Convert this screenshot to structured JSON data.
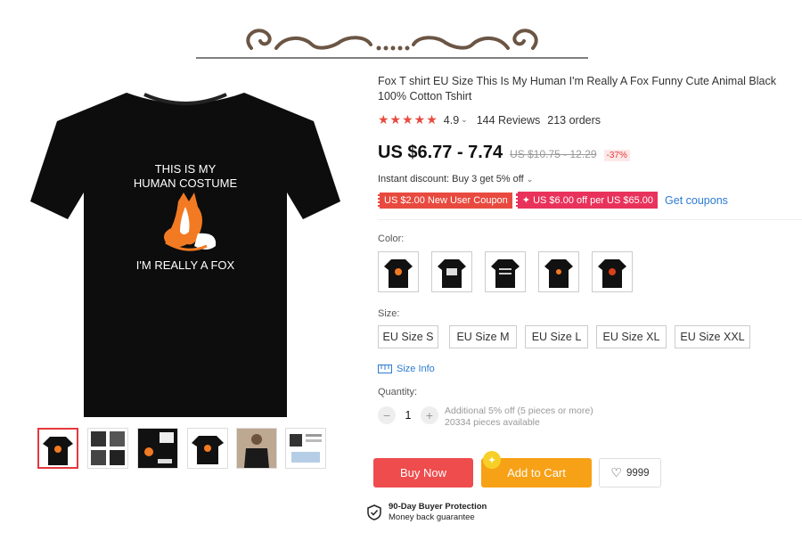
{
  "product": {
    "title": "Fox T shirt EU Size This Is My Human I'm Really A Fox Funny Cute Animal Black 100% Cotton Tshirt",
    "shirt_text_line1": "THIS IS MY",
    "shirt_text_line2": "HUMAN COSTUME",
    "shirt_text_line3": "I'M REALLY A FOX",
    "rating": "4.9",
    "stars": "★★★★★",
    "reviews": "144 Reviews",
    "orders": "213 orders",
    "price": "US $6.77 - 7.74",
    "old_price": "US $10.75 - 12.29",
    "discount": "-37%"
  },
  "promotions": {
    "instant_discount": "Instant discount: Buy 3 get 5% off",
    "coupon1": "US $2.00 New User Coupon",
    "coupon2": "✦ US $6.00 off per US $65.00",
    "get_coupons": "Get coupons"
  },
  "color": {
    "label": "Color:",
    "options": [
      "fox",
      "fox-alt",
      "text",
      "fox-small",
      "fox-red"
    ]
  },
  "size": {
    "label": "Size:",
    "options": [
      "EU Size S",
      "EU Size M",
      "EU Size L",
      "EU Size XL",
      "EU Size XXL"
    ],
    "size_info": "Size Info"
  },
  "quantity": {
    "label": "Quantity:",
    "value": "1",
    "minus": "−",
    "plus": "+",
    "note1": "Additional 5% off (5 pieces or more)",
    "note2": "20334 pieces available"
  },
  "actions": {
    "buy_now": "Buy Now",
    "add_to_cart": "Add to Cart",
    "wishlist_count": "9999"
  },
  "protection": {
    "title": "90-Day Buyer Protection",
    "subtitle": "Money back guarantee"
  },
  "colors": {
    "accent_red": "#ee4c4d",
    "accent_orange": "#f7a117",
    "link_blue": "#2c7bd2"
  }
}
